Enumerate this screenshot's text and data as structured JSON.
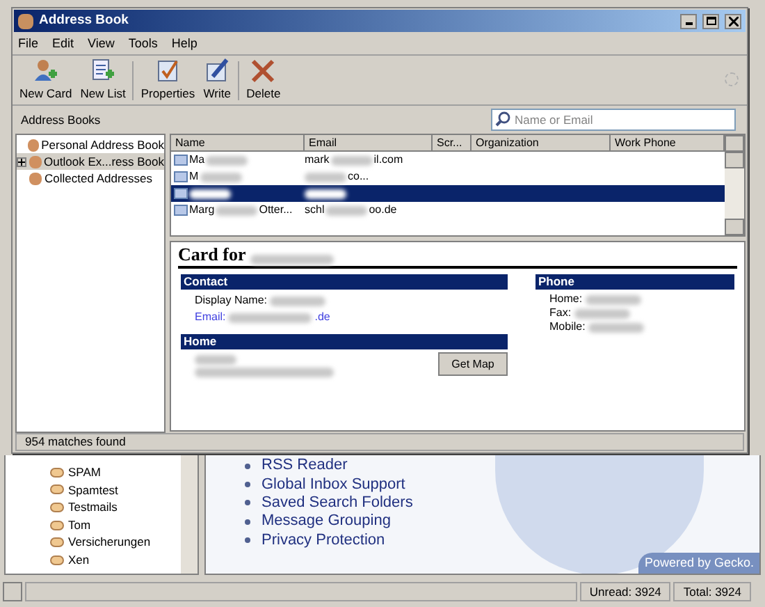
{
  "window": {
    "title": "Address Book"
  },
  "menu": [
    "File",
    "Edit",
    "View",
    "Tools",
    "Help"
  ],
  "toolbar": [
    {
      "label": "New Card",
      "kind": "newcard"
    },
    {
      "label": "New List",
      "kind": "newlist"
    },
    {
      "label": "Properties",
      "kind": "properties"
    },
    {
      "label": "Write",
      "kind": "write"
    },
    {
      "label": "Delete",
      "kind": "delete"
    }
  ],
  "address_books_label": "Address Books",
  "search": {
    "placeholder": "Name or Email"
  },
  "address_books": [
    {
      "label": "Personal Address Book",
      "selected": false,
      "expandable": false
    },
    {
      "label": "Outlook Ex...ress Book",
      "selected": true,
      "expandable": true
    },
    {
      "label": "Collected Addresses",
      "selected": false,
      "expandable": false
    }
  ],
  "columns": [
    "Name",
    "Email",
    "Scr...",
    "Organization",
    "Work Phone"
  ],
  "rows": [
    {
      "name": "Ma",
      "email": "mark",
      "email_tail": "il.com",
      "selected": false
    },
    {
      "name": "M",
      "email_tail": "co...",
      "selected": false
    },
    {
      "selected": true
    },
    {
      "name": "Marg",
      "name_tail": "Otter...",
      "email": "schl",
      "email_tail": "oo.de",
      "selected": false
    }
  ],
  "card": {
    "title": "Card for",
    "contact_heading": "Contact",
    "display_name_label": "Display Name:",
    "email_label": "Email:",
    "email_tail": ".de",
    "home_heading": "Home",
    "get_map": "Get Map",
    "phone_heading": "Phone",
    "phone_labels": [
      "Home:",
      "Fax:",
      "Mobile:"
    ]
  },
  "status": "954 matches found",
  "background": {
    "folders": [
      "SPAM",
      "Spamtest",
      "Testmails",
      "Tom",
      "Versicherungen",
      "Xen"
    ],
    "features": [
      "RSS Reader",
      "Global Inbox Support",
      "Saved Search Folders",
      "Message Grouping",
      "Privacy Protection"
    ],
    "banner": "Powered by Gecko.",
    "unread": "Unread: 3924",
    "total": "Total: 3924"
  }
}
